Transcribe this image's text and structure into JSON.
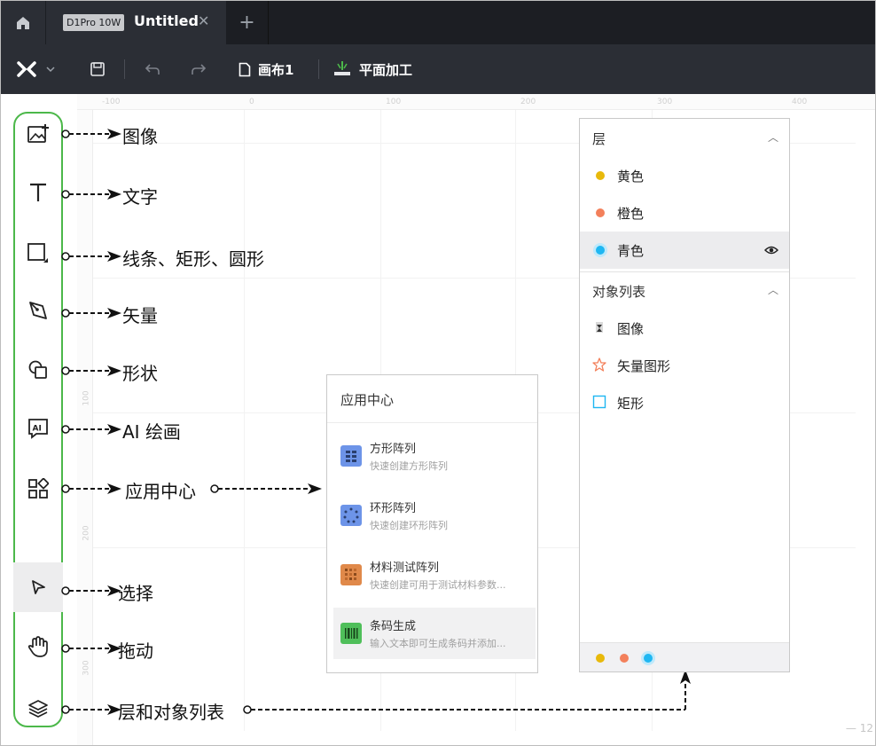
{
  "tabbar": {
    "device_badge": "D1Pro 10W",
    "doc_title": "Untitled",
    "close_symbol": "✕",
    "add_symbol": "+"
  },
  "toolbar": {
    "canvas_label": "画布1",
    "mode_label": "平面加工"
  },
  "ruler": {
    "top_labels": [
      "-100",
      "0",
      "100",
      "200",
      "300",
      "400"
    ],
    "left_labels": [
      "100",
      "200",
      "300",
      "400"
    ]
  },
  "zoom": "— 12",
  "annotations": {
    "image": "图像",
    "text": "文字",
    "line_rect_circle": "线条、矩形、圆形",
    "vector": "矢量",
    "shape": "形状",
    "ai_draw": "AI 绘画",
    "app_center": "应用中心",
    "select": "选择",
    "drag": "拖动",
    "layers_objects": "层和对象列表"
  },
  "app_center": {
    "title": "应用中心",
    "items": [
      {
        "name": "方形阵列",
        "desc": "快速创建方形阵列"
      },
      {
        "name": "环形阵列",
        "desc": "快速创建环形阵列"
      },
      {
        "name": "材料测试阵列",
        "desc": "快速创建可用于测试材料参数..."
      },
      {
        "name": "条码生成",
        "desc": "输入文本即可生成条码并添加..."
      }
    ]
  },
  "layer_panel": {
    "layers_header": "层",
    "layers": [
      {
        "name": "黄色",
        "color": "#e8b90b"
      },
      {
        "name": "橙色",
        "color": "#f3805b"
      },
      {
        "name": "青色",
        "color": "#1fb7f2"
      }
    ],
    "objects_header": "对象列表",
    "objects": [
      {
        "name": "图像",
        "icon": "image-object-icon"
      },
      {
        "name": "矢量图形",
        "icon": "star-outline-icon"
      },
      {
        "name": "矩形",
        "icon": "rectangle-outline-icon"
      }
    ]
  },
  "colors": {
    "accent_green": "#4cb84a",
    "toolbar_bg": "#2b2e35",
    "tabbar_bg": "#1c1e23"
  }
}
